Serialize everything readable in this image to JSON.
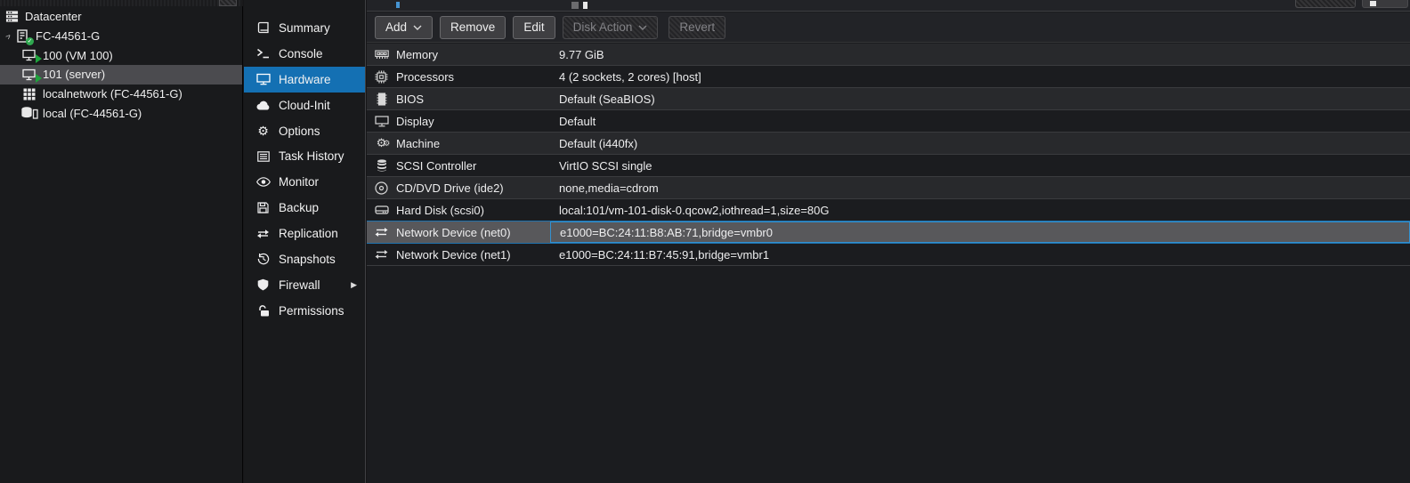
{
  "colors": {
    "accent_blue": "#1470b3",
    "selected_row_bg": "#58585b",
    "selected_row_border": "#1f72ad",
    "tree_selected_bg": "#4b4b4f",
    "status_green": "#2fa84f"
  },
  "sidebar": {
    "tree": [
      {
        "label": "Datacenter",
        "icon": "datacenter-icon"
      },
      {
        "label": "FC-44561-G",
        "icon": "node-icon",
        "status": "online",
        "expanded": true
      },
      {
        "label": "100 (VM 100)",
        "icon": "vm-running-icon"
      },
      {
        "label": "101 (server)",
        "icon": "vm-running-icon",
        "selected": true
      },
      {
        "label": "localnetwork (FC-44561-G)",
        "icon": "network-grid-icon"
      },
      {
        "label": "local (FC-44561-G)",
        "icon": "storage-icon"
      }
    ]
  },
  "menu": {
    "items": [
      {
        "label": "Summary",
        "icon": "book-icon"
      },
      {
        "label": "Console",
        "icon": "terminal-icon"
      },
      {
        "label": "Hardware",
        "icon": "display-icon",
        "selected": true
      },
      {
        "label": "Cloud-Init",
        "icon": "cloud-icon"
      },
      {
        "label": "Options",
        "icon": "gear-icon"
      },
      {
        "label": "Task History",
        "icon": "list-icon"
      },
      {
        "label": "Monitor",
        "icon": "eye-icon"
      },
      {
        "label": "Backup",
        "icon": "floppy-icon"
      },
      {
        "label": "Replication",
        "icon": "replication-arrows-icon"
      },
      {
        "label": "Snapshots",
        "icon": "history-icon"
      },
      {
        "label": "Firewall",
        "icon": "shield-icon",
        "has_submenu": true
      },
      {
        "label": "Permissions",
        "icon": "unlock-icon"
      }
    ]
  },
  "toolbar": {
    "buttons": [
      {
        "label": "Add",
        "dropdown": true,
        "enabled": true
      },
      {
        "label": "Remove",
        "dropdown": false,
        "enabled": true
      },
      {
        "label": "Edit",
        "dropdown": false,
        "enabled": true
      },
      {
        "label": "Disk Action",
        "dropdown": true,
        "enabled": false
      },
      {
        "label": "Revert",
        "dropdown": false,
        "enabled": false
      }
    ]
  },
  "hardware": {
    "rows": [
      {
        "name": "Memory",
        "value": "9.77 GiB",
        "icon": "memory-icon"
      },
      {
        "name": "Processors",
        "value": "4 (2 sockets, 2 cores) [host]",
        "icon": "cpu-icon"
      },
      {
        "name": "BIOS",
        "value": "Default (SeaBIOS)",
        "icon": "bios-chip-icon"
      },
      {
        "name": "Display",
        "value": "Default",
        "icon": "display-icon"
      },
      {
        "name": "Machine",
        "value": "Default (i440fx)",
        "icon": "gears-icon"
      },
      {
        "name": "SCSI Controller",
        "value": "VirtIO SCSI single",
        "icon": "database-icon"
      },
      {
        "name": "CD/DVD Drive (ide2)",
        "value": "none,media=cdrom",
        "icon": "disc-icon"
      },
      {
        "name": "Hard Disk (scsi0)",
        "value": "local:101/vm-101-disk-0.qcow2,iothread=1,size=80G",
        "icon": "hdd-icon"
      },
      {
        "name": "Network Device (net0)",
        "value": "e1000=BC:24:11:B8:AB:71,bridge=vmbr0",
        "icon": "network-arrows-icon",
        "selected": true
      },
      {
        "name": "Network Device (net1)",
        "value": "e1000=BC:24:11:B7:45:91,bridge=vmbr1",
        "icon": "network-arrows-icon"
      }
    ]
  }
}
